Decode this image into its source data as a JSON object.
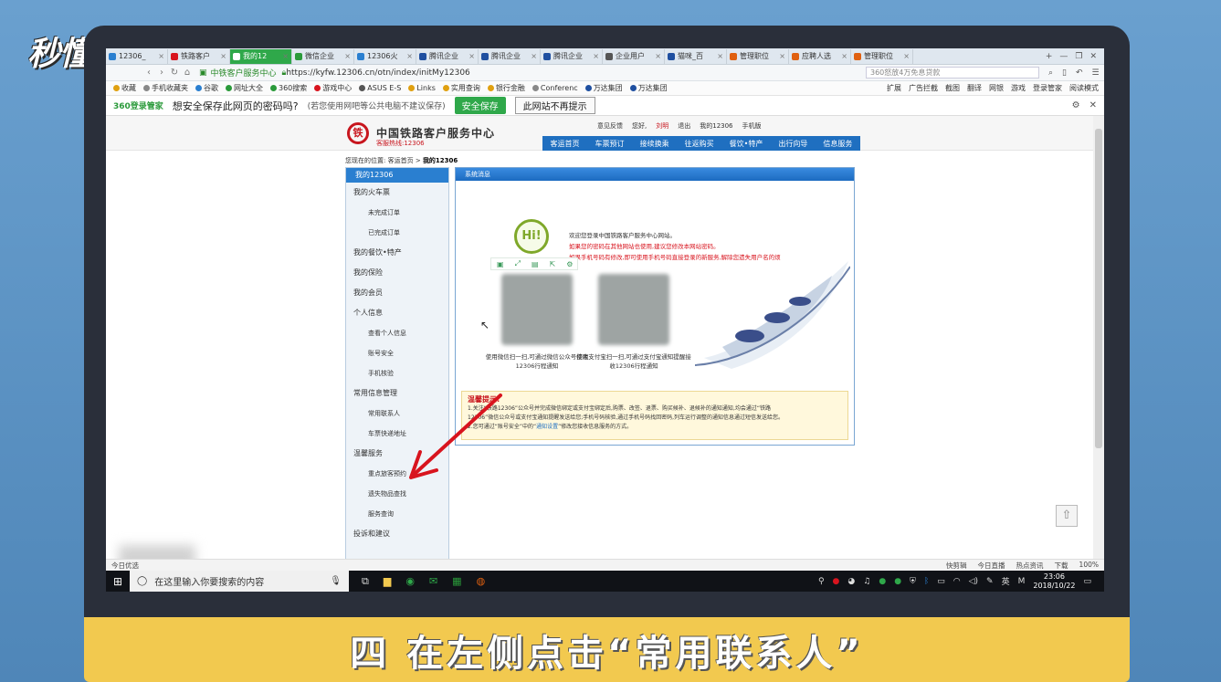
{
  "watermark": "秒懂视频",
  "caption": "四 在左侧点击“常用联系人”",
  "browser": {
    "tabs": [
      {
        "label": "12306_",
        "color": "#2a7fd0",
        "active": false
      },
      {
        "label": "铁路客户",
        "color": "#d8141e",
        "active": false
      },
      {
        "label": "我的12",
        "color": "#ffffff",
        "active": true
      },
      {
        "label": "微信企业",
        "color": "#2a9a3a",
        "active": false
      },
      {
        "label": "12306火",
        "color": "#2a7fd0",
        "active": false
      },
      {
        "label": "腾讯企业",
        "color": "#1f4fa0",
        "active": false
      },
      {
        "label": "腾讯企业",
        "color": "#1f4fa0",
        "active": false
      },
      {
        "label": "腾讯企业",
        "color": "#1f4fa0",
        "active": false
      },
      {
        "label": "企业用户",
        "color": "#555555",
        "active": false
      },
      {
        "label": "猫咪_百",
        "color": "#1f4fa0",
        "active": false
      },
      {
        "label": "管理职位",
        "color": "#e06010",
        "active": false
      },
      {
        "label": "应聘人选",
        "color": "#e06010",
        "active": false
      },
      {
        "label": "管理职位",
        "color": "#e06010",
        "active": false
      }
    ],
    "tab_close": "×",
    "new_tab": "+",
    "site_name": "中铁客户服务中心",
    "url": "https://kyfw.12306.cn/otn/index/initMy12306",
    "search_placeholder": "360怒放4万免息贷款",
    "bookmarks": [
      "收藏",
      "手机收藏夹",
      "谷歌",
      "网址大全",
      "360搜索",
      "游戏中心",
      "ASUS E-S",
      "Links",
      "实用查询",
      "银行金融",
      "Conferenc",
      "万达集团",
      "万达集团"
    ],
    "bookmarks_right": [
      "扩展",
      "广告拦截",
      "截图",
      "翻译",
      "网银",
      "游戏",
      "登录管家",
      "阅读模式"
    ],
    "notice": {
      "brand": "360登录管家",
      "question": "想安全保存此网页的密码吗?",
      "hint": "(若您使用网吧等公共电脑不建议保存)",
      "save_btn": "安全保存",
      "no_btn": "此网站不再提示"
    }
  },
  "site": {
    "logo_char": "铁",
    "title": "中国铁路客户服务中心",
    "hotline": "客服热线:12306",
    "top_links": [
      "意见反馈",
      "您好,",
      "刘明",
      "退出",
      "我的12306",
      "手机版"
    ],
    "nav": [
      "客运首页",
      "车票预订",
      "接续换乘",
      "往返购买",
      "餐饮•特产",
      "出行向导",
      "信息服务"
    ],
    "breadcrumb_prefix": "您现在的位置:",
    "breadcrumb_home": "客运首页",
    "breadcrumb_sep": ">",
    "breadcrumb_current": "我的12306"
  },
  "sidebar": {
    "head": "我的12306",
    "items": [
      {
        "label": "我的火车票",
        "sub": false
      },
      {
        "label": "未完成订单",
        "sub": true
      },
      {
        "label": "已完成订单",
        "sub": true
      },
      {
        "label": "我的餐饮•特产",
        "sub": false
      },
      {
        "label": "我的保险",
        "sub": false
      },
      {
        "label": "我的会员",
        "sub": false
      },
      {
        "label": "个人信息",
        "sub": false
      },
      {
        "label": "查看个人信息",
        "sub": true
      },
      {
        "label": "账号安全",
        "sub": true
      },
      {
        "label": "手机核验",
        "sub": true
      },
      {
        "label": "常用信息管理",
        "sub": false
      },
      {
        "label": "常用联系人",
        "sub": true
      },
      {
        "label": "车票快递地址",
        "sub": true
      },
      {
        "label": "温馨服务",
        "sub": false
      },
      {
        "label": "重点旅客预约",
        "sub": true
      },
      {
        "label": "遗失物品查找",
        "sub": true
      },
      {
        "label": "服务查询",
        "sub": true
      },
      {
        "label": "投诉和建议",
        "sub": false
      }
    ]
  },
  "panel": {
    "head": "系统消息",
    "hi": "Hi!",
    "welcome_line1": "欢迎您登录中国铁路客户服务中心网站。",
    "welcome_line2": "如果您的密码在其他网站也使用,建议您修改本网站密码。",
    "welcome_line3": "如果手机号码有修改,即可使用手机号码直接登录的新服务,解除您遗失用户名的烦",
    "qr1_caption": "使用微信扫一扫,可通过微信公众号接收12306行程通知",
    "qr2_caption": "使用支付宝扫一扫,可通过支付宝通知提醒接收12306行程通知",
    "tips_title": "温馨提示:",
    "tips_line1": "1.关注“铁路12306”公众号并完成微信绑定或支付宝绑定后,购票、改签、退票、购买候补、退候补的通知通知,均会通过“铁路",
    "tips_line2": "12306”微信公众号或支付宝通知提醒发送给您;手机号码核验,通过手机号码找回密码,列车运行调整的通知信息通过短信发送给您。",
    "tips_line3_a": "2.您可通过“账号安全”中的“",
    "tips_link": "通知设置",
    "tips_line3_b": "”修改您接收信息服务的方式。"
  },
  "statusbar": {
    "left": "今日优选",
    "right": [
      "快剪辑",
      "今日直播",
      "热点资讯",
      "下载",
      "100%"
    ]
  },
  "taskbar": {
    "search": "在这里输入你要搜索的内容",
    "ime": "英",
    "time": "23:06",
    "date": "2018/10/22"
  },
  "colors": {
    "accent_blue": "#1f6fc0",
    "rail_red": "#c8161e",
    "green_360": "#2fa84a",
    "arrow_red": "#d8141e",
    "caption_band": "#f2c94f"
  }
}
